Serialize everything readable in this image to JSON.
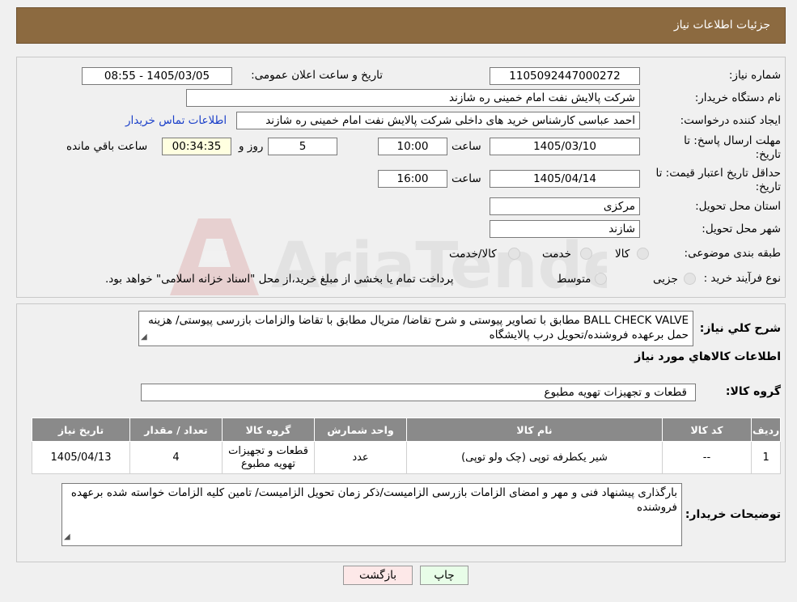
{
  "header": {
    "title": "جزئیات اطلاعات نیاز"
  },
  "form": {
    "need_number_label": "شماره نیاز:",
    "need_number": "1105092447000272",
    "announce_label": "تاریخ و ساعت اعلان عمومی:",
    "announce_value": "1405/03/05 - 08:55",
    "buyer_org_label": "نام دستگاه خریدار:",
    "buyer_org": "شرکت پالایش نفت امام خمینی  ره  شازند",
    "creator_label": "ایجاد کننده درخواست:",
    "creator": "احمد عباسی کارشناس خرید های داخلی  شرکت پالایش نفت امام خمینی  ره  شازند",
    "contact_link": "اطلاعات تماس خریدار",
    "deadline_label": "مهلت ارسال پاسخ: تا تاریخ:",
    "deadline_date": "1405/03/10",
    "time_label": "ساعت",
    "deadline_time": "10:00",
    "days_value": "5",
    "days_label": "روز و",
    "remaining_time": "00:34:35",
    "remaining_label": "ساعت باقي مانده",
    "price_validity_label": "حداقل تاریخ اعتبار قیمت: تا تاریخ:",
    "price_validity_date": "1405/04/14",
    "price_validity_time": "16:00",
    "province_label": "استان محل تحویل:",
    "province": "مرکزی",
    "city_label": "شهر محل تحویل:",
    "city": "شازند",
    "category_label": "طبقه بندی موضوعی:",
    "category_options": [
      "کالا",
      "خدمت",
      "کالا/خدمت"
    ],
    "process_label": "نوع فرآیند خرید :",
    "process_options": [
      "جزیی",
      "متوسط"
    ],
    "process_note": "پرداخت تمام یا بخشی از مبلغ خرید،از محل \"اسناد خزانه اسلامی\" خواهد بود."
  },
  "summary": {
    "label": "شرح کلي نياز:",
    "text": "BALL CHECK VALVE مطابق با تصاویر پیوستی و شرح تقاضا/ متریال مطابق با تقاضا والزامات بازرسی پیوستی/ هزینه حمل برعهده فروشنده/تحویل درب پالایشگاه",
    "goods_info_title": "اطلاعات کالاهاي مورد نياز",
    "goods_group_label": "گروه کالا:",
    "goods_group": "قطعات و تجهیزات تهویه مطبوع"
  },
  "table": {
    "headers": [
      "ردیف",
      "کد کالا",
      "نام کالا",
      "واحد شمارش",
      "گروه کالا",
      "تعداد / مقدار",
      "تاریخ نیاز"
    ],
    "rows": [
      [
        "1",
        "--",
        "شیر یکطرفه توپی (چک ولو توپی)",
        "عدد",
        "قطعات و تجهیزات تهویه مطبوع",
        "4",
        "1405/04/13"
      ]
    ]
  },
  "buyer_notes": {
    "label": "توضیحات خریدار:",
    "text": "بارگذاری پیشنهاد فنی و مهر و امضای الزامات بازرسی الزامیست/ذکر زمان تحویل الزامیست/ تامین کلیه الزامات خواسته شده برعهده فروشنده"
  },
  "buttons": {
    "print": "چاپ",
    "back": "بازگشت"
  },
  "watermark": {
    "text": "AriaTender.neT"
  },
  "colors": {
    "header_bg": "#8c6a40",
    "link": "#1a3fc9",
    "table_header": "#8a8a8a"
  }
}
